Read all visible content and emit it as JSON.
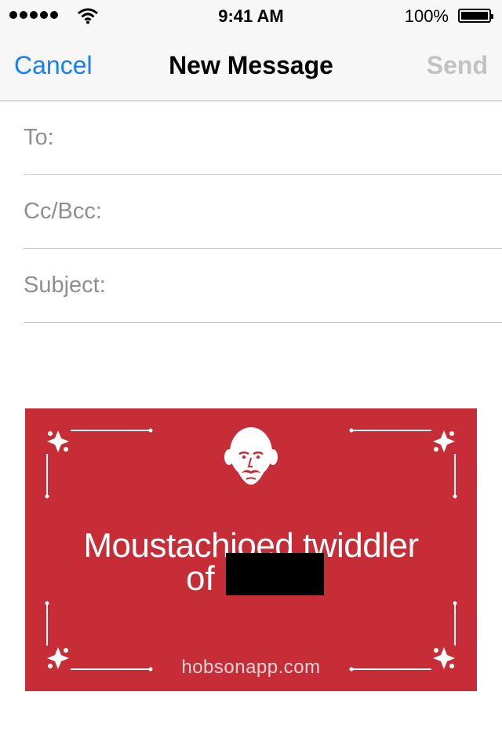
{
  "status_bar": {
    "time": "9:41 AM",
    "battery_percent": "100%",
    "signal_bars": 5,
    "icons": [
      "signal-dots-icon",
      "wifi-icon",
      "battery-icon"
    ]
  },
  "nav": {
    "cancel": "Cancel",
    "title": "New Message",
    "send": "Send"
  },
  "fields": {
    "to_label": "To:",
    "to_value": "",
    "cc_label": "Cc/Bcc:",
    "cc_value": "",
    "subject_label": "Subject:",
    "subject_value": ""
  },
  "card": {
    "line1": "Moustachioed twiddler",
    "line2": "of",
    "url": "hobsonapp.com",
    "icons": [
      "bald-moustache-face-icon",
      "corner-ornament-icon"
    ]
  },
  "colors": {
    "accent": "#157efb",
    "send_disabled": "#c2c2c2",
    "card_background": "#c62d37",
    "label_gray": "#8e8e93"
  }
}
